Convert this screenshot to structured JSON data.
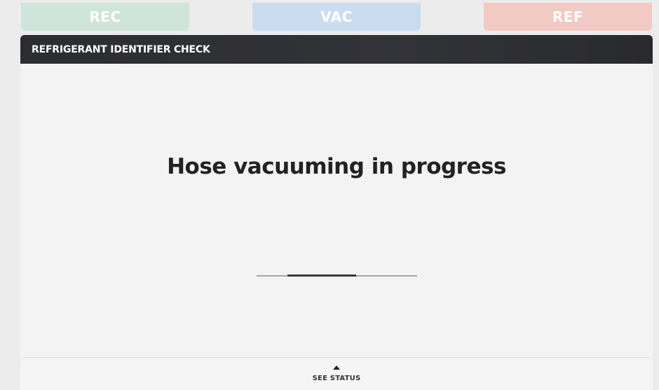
{
  "tabs": [
    {
      "label": "REC",
      "color": "#cfe4db"
    },
    {
      "label": "VAC",
      "color": "#cbdcf0"
    },
    {
      "label": "REF",
      "color": "#f3c9c3"
    }
  ],
  "panel": {
    "title": "REFRIGERANT IDENTIFIER CHECK",
    "header_color": "#2f3034"
  },
  "main": {
    "message": "Hose vacuuming in progress"
  },
  "progress": {
    "indeterminate": true,
    "position_fraction": 0.19,
    "fill_fraction": 0.43
  },
  "status_bar": {
    "label": "SEE STATUS",
    "icon": "chevron-up-icon"
  }
}
